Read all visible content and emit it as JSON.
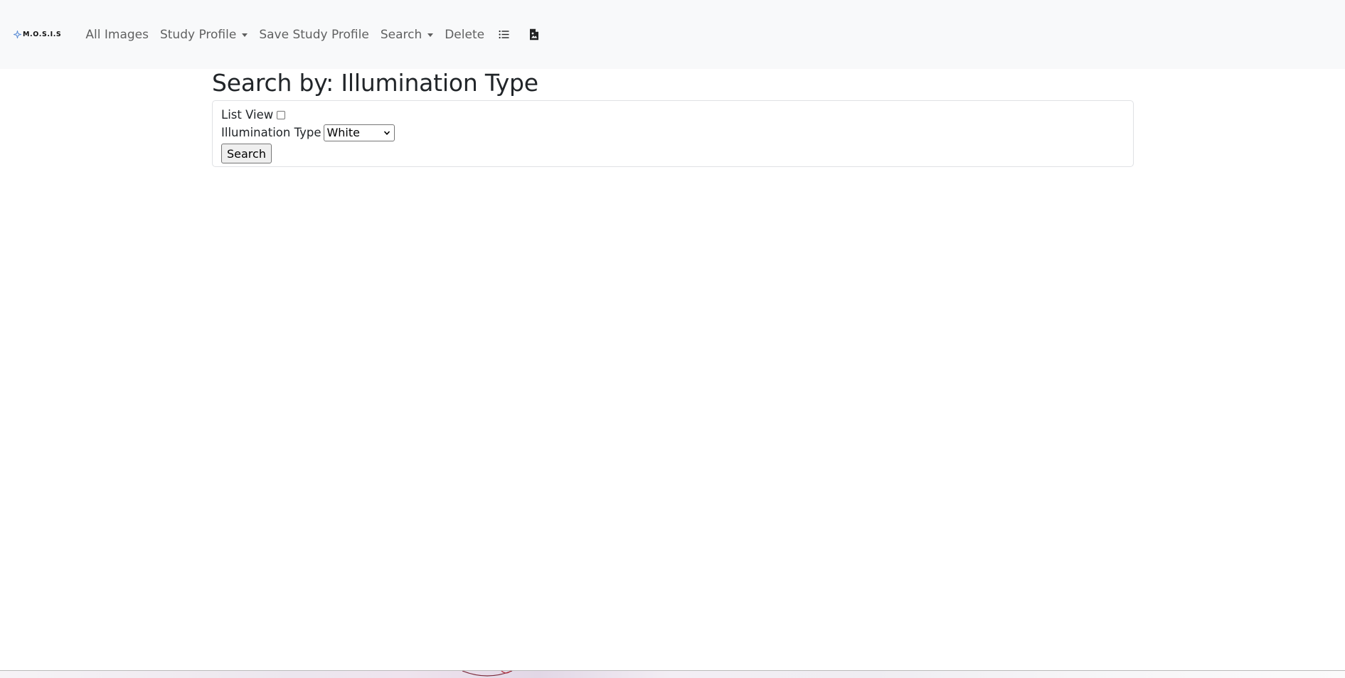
{
  "navbar": {
    "brand": "M.O.S.I.S",
    "items": [
      {
        "label": "All Images",
        "dropdown": false
      },
      {
        "label": "Study Profile",
        "dropdown": true
      },
      {
        "label": "Save Study Profile",
        "dropdown": false
      },
      {
        "label": "Search",
        "dropdown": true
      },
      {
        "label": "Delete",
        "dropdown": false
      }
    ],
    "icons": [
      "list-icon",
      "file-image-icon"
    ]
  },
  "page": {
    "title": "Search by: Illumination Type"
  },
  "form": {
    "list_view_label": "List View",
    "list_view_checked": false,
    "illumination_label": "Illumination Type",
    "illumination_value": "White",
    "search_button": "Search"
  },
  "colors": {
    "navbar_bg": "#f8f9fa",
    "text": "#212529",
    "brand_accent": "#5b8dd6"
  }
}
